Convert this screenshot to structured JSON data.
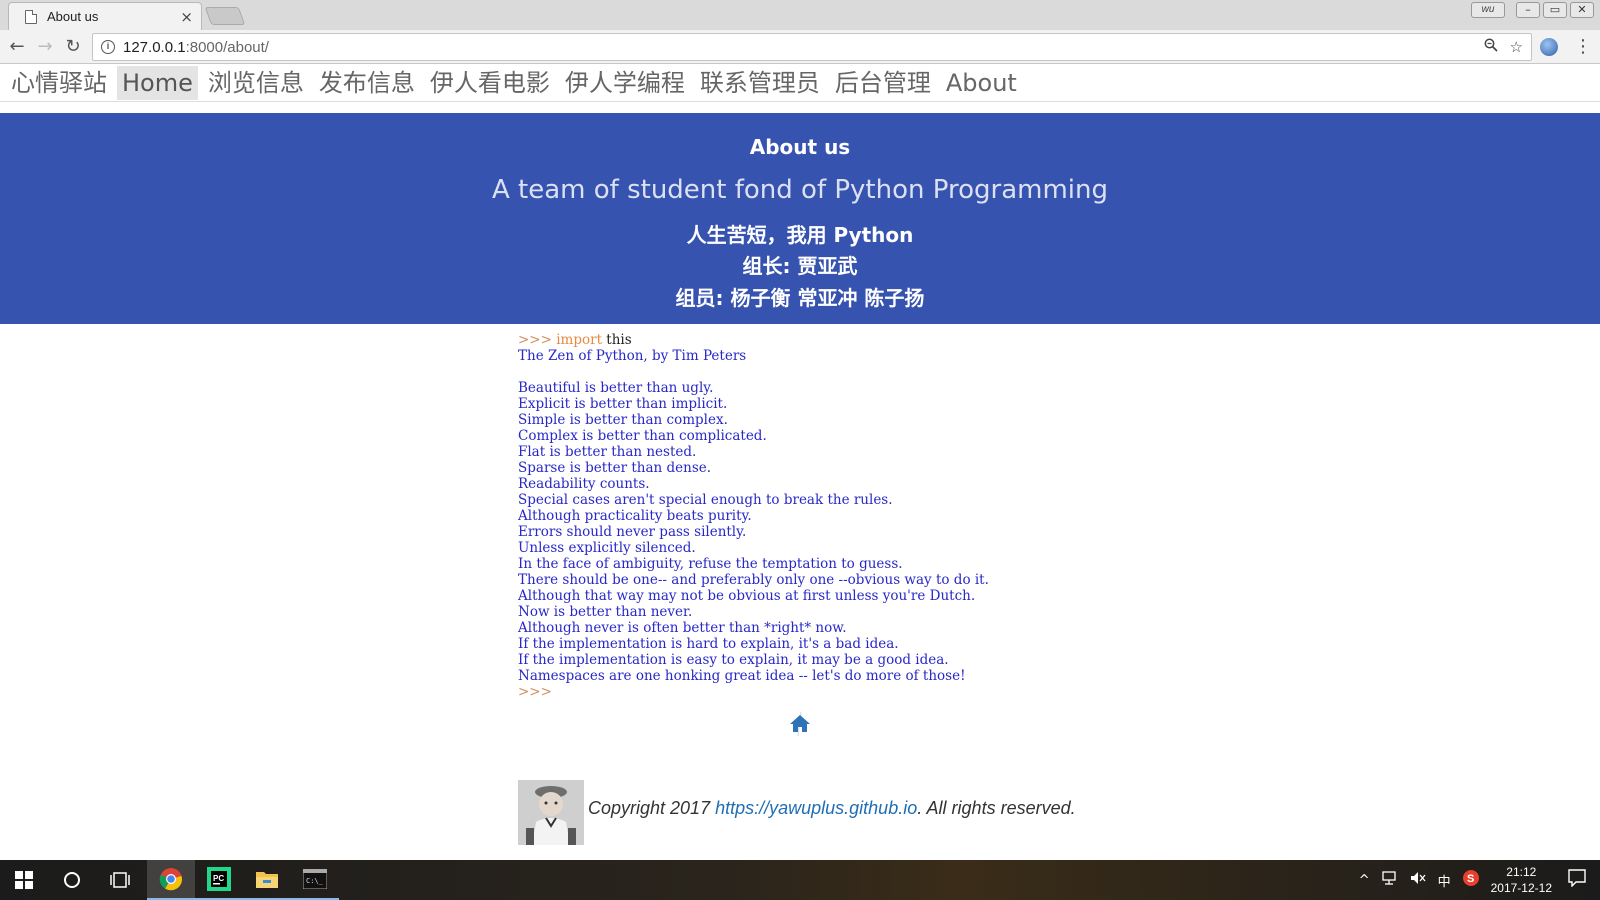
{
  "browser": {
    "tab_title": "About us",
    "tab_close": "×",
    "url_host": "127.0.0.1",
    "url_path": ":8000/about/",
    "user_badge": "wu",
    "win_min": "–",
    "win_restore": "▭",
    "win_close": "✕"
  },
  "nav": {
    "items": [
      {
        "label": "心情驿站"
      },
      {
        "label": "Home"
      },
      {
        "label": "浏览信息"
      },
      {
        "label": "发布信息"
      },
      {
        "label": "伊人看电影"
      },
      {
        "label": "伊人学编程"
      },
      {
        "label": "联系管理员"
      },
      {
        "label": "后台管理"
      },
      {
        "label": "About"
      }
    ]
  },
  "hero": {
    "title": "About us",
    "subtitle": "A team of student fond of Python Programming",
    "motto": "人生苦短，我用 Python",
    "leader": "组长: 贾亚武",
    "members": "组员: 杨子衡 常亚冲 陈子扬"
  },
  "code": {
    "prompt": ">>> ",
    "keyword": "import",
    "module": " this",
    "lines": [
      "The Zen of Python, by Tim Peters",
      "",
      "Beautiful is better than ugly.",
      "Explicit is better than implicit.",
      "Simple is better than complex.",
      "Complex is better than complicated.",
      "Flat is better than nested.",
      "Sparse is better than dense.",
      "Readability counts.",
      "Special cases aren't special enough to break the rules.",
      "Although practicality beats purity.",
      "Errors should never pass silently.",
      "Unless explicitly silenced.",
      "In the face of ambiguity, refuse the temptation to guess.",
      "There should be one-- and preferably only one --obvious way to do it.",
      "Although that way may not be obvious at first unless you're Dutch.",
      "Now is better than never.",
      "Although never is often better than *right* now.",
      "If the implementation is hard to explain, it's a bad idea.",
      "If the implementation is easy to explain, it may be a good idea.",
      "Namespaces are one honking great idea -- let's do more of those!"
    ],
    "end_prompt": ">>>"
  },
  "footer": {
    "copyright_prefix": "Copyright 2017 ",
    "link_text": "https://yawuplus.github.io",
    "copyright_suffix": ". All rights reserved."
  },
  "taskbar": {
    "ime": "中",
    "time": "21:12",
    "date": "2017-12-12"
  },
  "colors": {
    "hero_bg": "#3753b0",
    "code_text": "#2828c8",
    "link": "#1f6db5"
  }
}
